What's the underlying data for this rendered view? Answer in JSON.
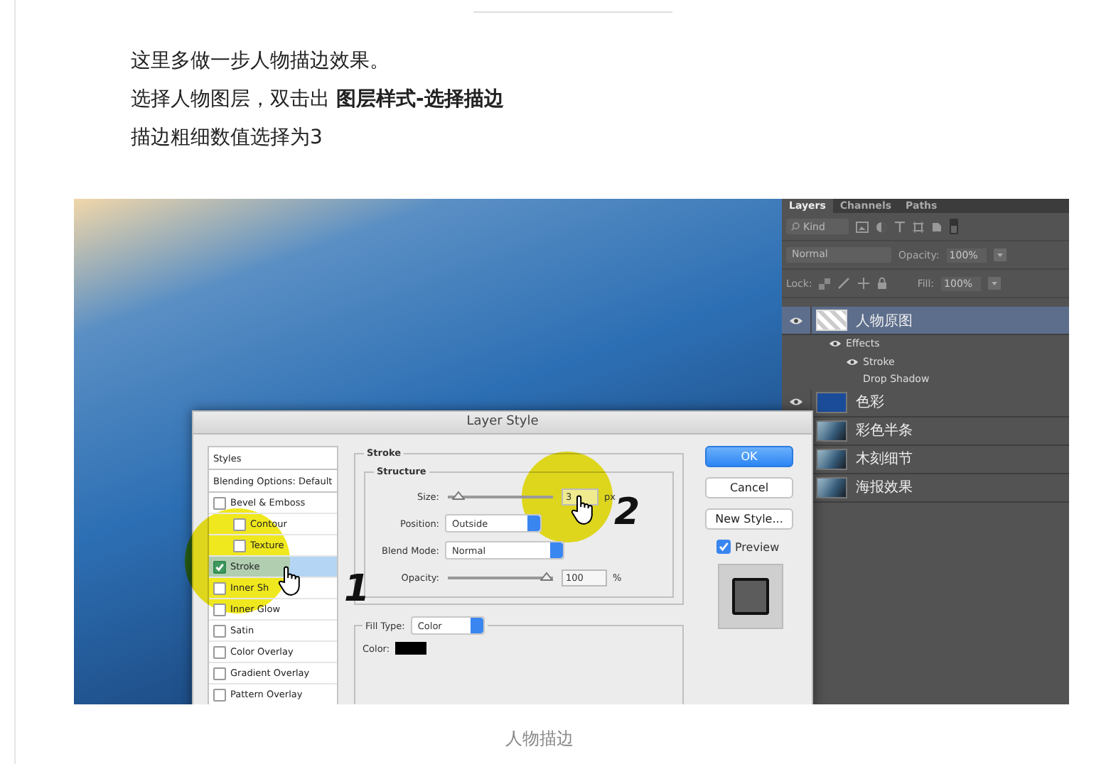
{
  "article": {
    "paragraphs": [
      "这里多做一步人物描边效果。",
      "选择人物图层，双击出 **图层样式-选择描边**",
      "描边粗细数值选择为3"
    ]
  },
  "screenshot": {
    "layers_panel": {
      "tabs": [
        {
          "label": "Layers",
          "selected": true
        },
        {
          "label": "Channels",
          "selected": false
        },
        {
          "label": "Paths",
          "selected": false
        }
      ],
      "filter": "Kind",
      "blend_mode": "Normal",
      "opacity_label": "Opacity:",
      "opacity_value": "100%",
      "lock_label": "Lock:",
      "fill_label": "Fill:",
      "fill_value": "100%",
      "layers": [
        {
          "name": "人物原图",
          "kind": "cutout",
          "visible": true,
          "selected": true,
          "effects": {
            "label": "Effects",
            "visible": true,
            "items": [
              {
                "name": "Stroke",
                "visible": true
              },
              {
                "name": "Drop Shadow",
                "visible": false
              }
            ]
          }
        },
        {
          "name": "色彩",
          "kind": "fill",
          "visible": true,
          "selected": false
        },
        {
          "name": "彩色半条",
          "kind": "image",
          "selected": false
        },
        {
          "name": "木刻细节",
          "kind": "image",
          "selected": false
        },
        {
          "name": "海报效果",
          "kind": "image",
          "selected": false
        }
      ]
    },
    "dialog": {
      "title": "Layer Style",
      "styles": [
        {
          "label": "Styles",
          "kind": "header"
        },
        {
          "label": "Blending Options: Default",
          "kind": "header"
        },
        {
          "label": "Bevel & Emboss",
          "kind": "check",
          "checked": false,
          "selected": false,
          "children": [
            {
              "label": "Contour",
              "kind": "check",
              "checked": false,
              "selected": false
            },
            {
              "label": "Texture",
              "kind": "check",
              "checked": false,
              "selected": false
            }
          ]
        },
        {
          "label": "Stroke",
          "kind": "check",
          "checked": true,
          "selected": true
        },
        {
          "label": "Inner Sh",
          "kind": "check",
          "checked": false,
          "selected": false
        },
        {
          "label": "Inner Glow",
          "kind": "check",
          "checked": false,
          "selected": false
        },
        {
          "label": "Satin",
          "kind": "check",
          "checked": false,
          "selected": false
        },
        {
          "label": "Color Overlay",
          "kind": "check",
          "checked": false,
          "selected": false
        },
        {
          "label": "Gradient Overlay",
          "kind": "check",
          "checked": false,
          "selected": false
        },
        {
          "label": "Pattern Overlay",
          "kind": "check",
          "checked": false,
          "selected": false
        }
      ],
      "group": "Stroke",
      "subgroup": "Structure",
      "size": {
        "label": "Size:",
        "level": 0.05,
        "value": "3",
        "unit": "px"
      },
      "position": {
        "label": "Position:",
        "value": "Outside"
      },
      "blend": {
        "label": "Blend Mode:",
        "value": "Normal"
      },
      "opacity": {
        "label": "Opacity:",
        "level": 1,
        "value": "100",
        "unit": "%"
      },
      "fill_type": {
        "label": "Fill Type:",
        "value": "Color"
      },
      "color": {
        "label": "Color:",
        "color": "#000000"
      },
      "buttons": [
        {
          "label": "OK",
          "kind": "primary"
        },
        {
          "label": "Cancel",
          "kind": "normal"
        },
        {
          "label": "New Style...",
          "kind": "normal"
        }
      ],
      "preview": {
        "label": "Preview",
        "checked": true
      }
    },
    "annotations": [
      {
        "label": "1"
      },
      {
        "label": "2"
      }
    ]
  },
  "caption": "人物描边"
}
